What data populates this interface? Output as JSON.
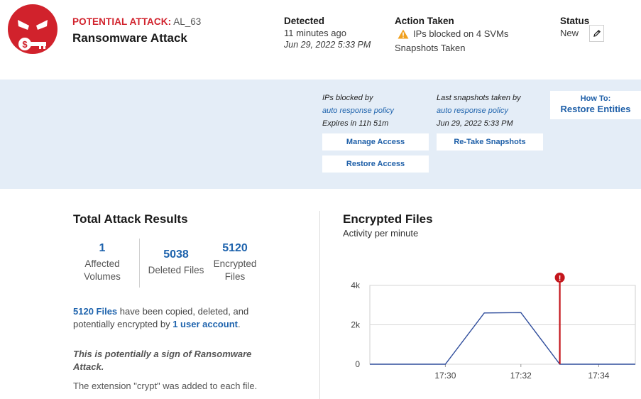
{
  "header": {
    "alert_type_label": "POTENTIAL ATTACK:",
    "alert_id": "AL_63",
    "title": "Ransomware Attack",
    "detected": {
      "label": "Detected",
      "relative": "11 minutes ago",
      "timestamp": "Jun 29, 2022 5:33 PM"
    },
    "action": {
      "label": "Action Taken",
      "ips_blocked": "IPs blocked on 4 SVMs",
      "snapshots": "Snapshots Taken",
      "warning_icon": "warning-triangle-icon"
    },
    "status": {
      "label": "Status",
      "value": "New",
      "edit_icon": "pencil-icon"
    }
  },
  "policy": {
    "ips": {
      "line1": "IPs blocked by",
      "link": "auto response policy",
      "line3": "Expires in 11h 51m"
    },
    "snapshots": {
      "line1": "Last snapshots taken by",
      "link": "auto response policy",
      "line3": "Jun 29, 2022 5:33 PM"
    },
    "buttons": {
      "manage_access": "Manage Access",
      "restore_access": "Restore Access",
      "retake_snapshots": "Re-Take Snapshots"
    },
    "howto": {
      "small": "How To:",
      "big": "Restore Entities"
    }
  },
  "results": {
    "title": "Total Attack Results",
    "stats": [
      {
        "value": "1",
        "caption": "Affected Volumes"
      },
      {
        "value": "5038",
        "caption": "Deleted Files"
      },
      {
        "value": "5120",
        "caption": "Encrypted Files"
      }
    ],
    "desc_files": "5120 Files",
    "desc_mid": " have been copied, deleted, and potentially encrypted by ",
    "desc_account": "1 user account",
    "desc_end": ".",
    "sign": "This is potentially a sign of Ransomware Attack.",
    "extension": "The extension \"crypt\" was added to each file."
  },
  "chart_data": {
    "type": "line",
    "title": "Encrypted Files",
    "subtitle": "Activity per minute",
    "xlabel": "",
    "ylabel": "",
    "x_ticks": [
      "17:30",
      "17:32",
      "17:34"
    ],
    "y_ticks": [
      "0",
      "2k",
      "4k"
    ],
    "ylim": [
      0,
      4000
    ],
    "series": [
      {
        "x": [
          17.467,
          17.5,
          17.517,
          17.533,
          17.55,
          17.567,
          17.583
        ],
        "values": [
          0,
          0,
          2600,
          2620,
          0,
          0,
          0
        ]
      }
    ],
    "line_color": "#2f4d9c",
    "marker": {
      "x": 17.55,
      "icon": "alert-circle-icon",
      "color": "#c4161c"
    },
    "grid": true
  }
}
